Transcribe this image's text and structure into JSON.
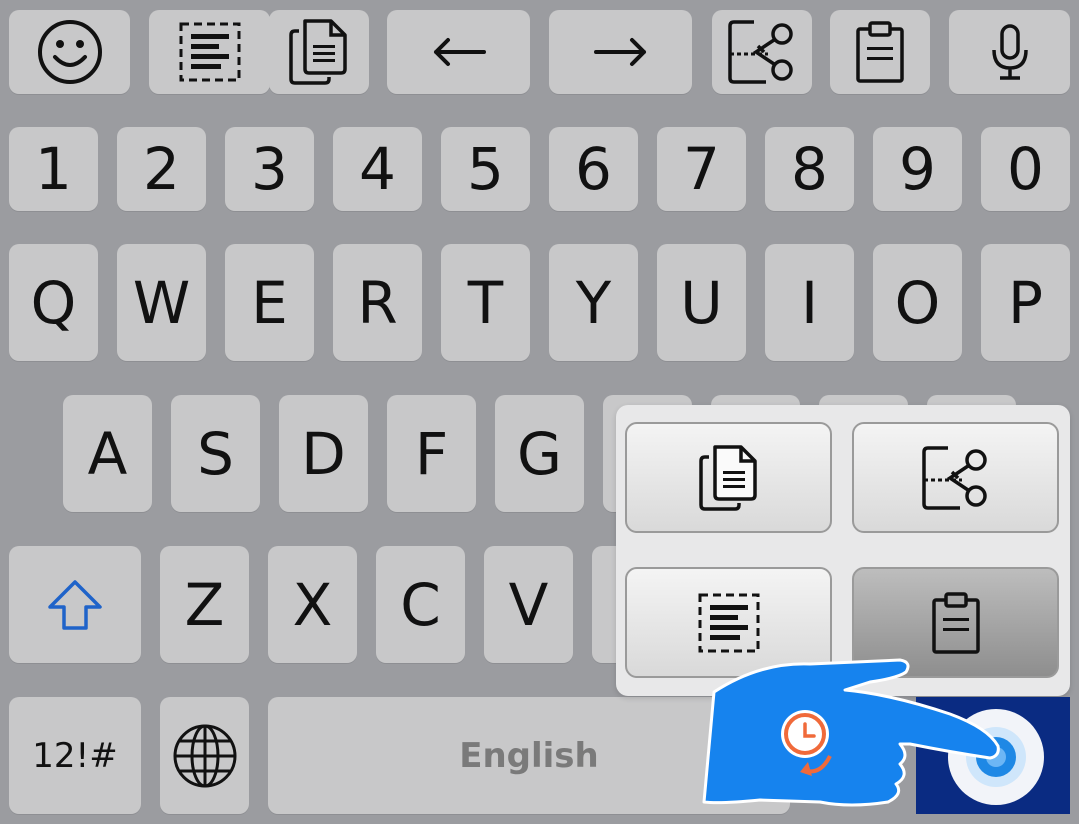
{
  "toolbar": {
    "items": [
      "emoji-icon",
      "select-all-icon",
      "copy-icon",
      "arrow-left-icon",
      "arrow-right-icon",
      "cut-icon",
      "clipboard-icon",
      "microphone-icon"
    ]
  },
  "rows": {
    "numbers": [
      "1",
      "2",
      "3",
      "4",
      "5",
      "6",
      "7",
      "8",
      "9",
      "0"
    ],
    "qwerty": [
      "Q",
      "W",
      "E",
      "R",
      "T",
      "Y",
      "U",
      "I",
      "O",
      "P"
    ],
    "asdf": [
      "A",
      "S",
      "D",
      "F",
      "G"
    ],
    "zxcv": [
      "Z",
      "X",
      "C",
      "V"
    ]
  },
  "bottom": {
    "symbols_label": "12!#",
    "space_label": "English"
  },
  "popup": {
    "items": [
      "copy-icon",
      "cut-icon",
      "select-all-icon",
      "clipboard-icon"
    ],
    "active": "clipboard-icon"
  },
  "colors": {
    "background": "#9b9ca0",
    "key": "#c8c8c9",
    "shift_arrow": "#1f63c9",
    "hand": "#1683ee",
    "vr_key": "#0a2b82"
  }
}
